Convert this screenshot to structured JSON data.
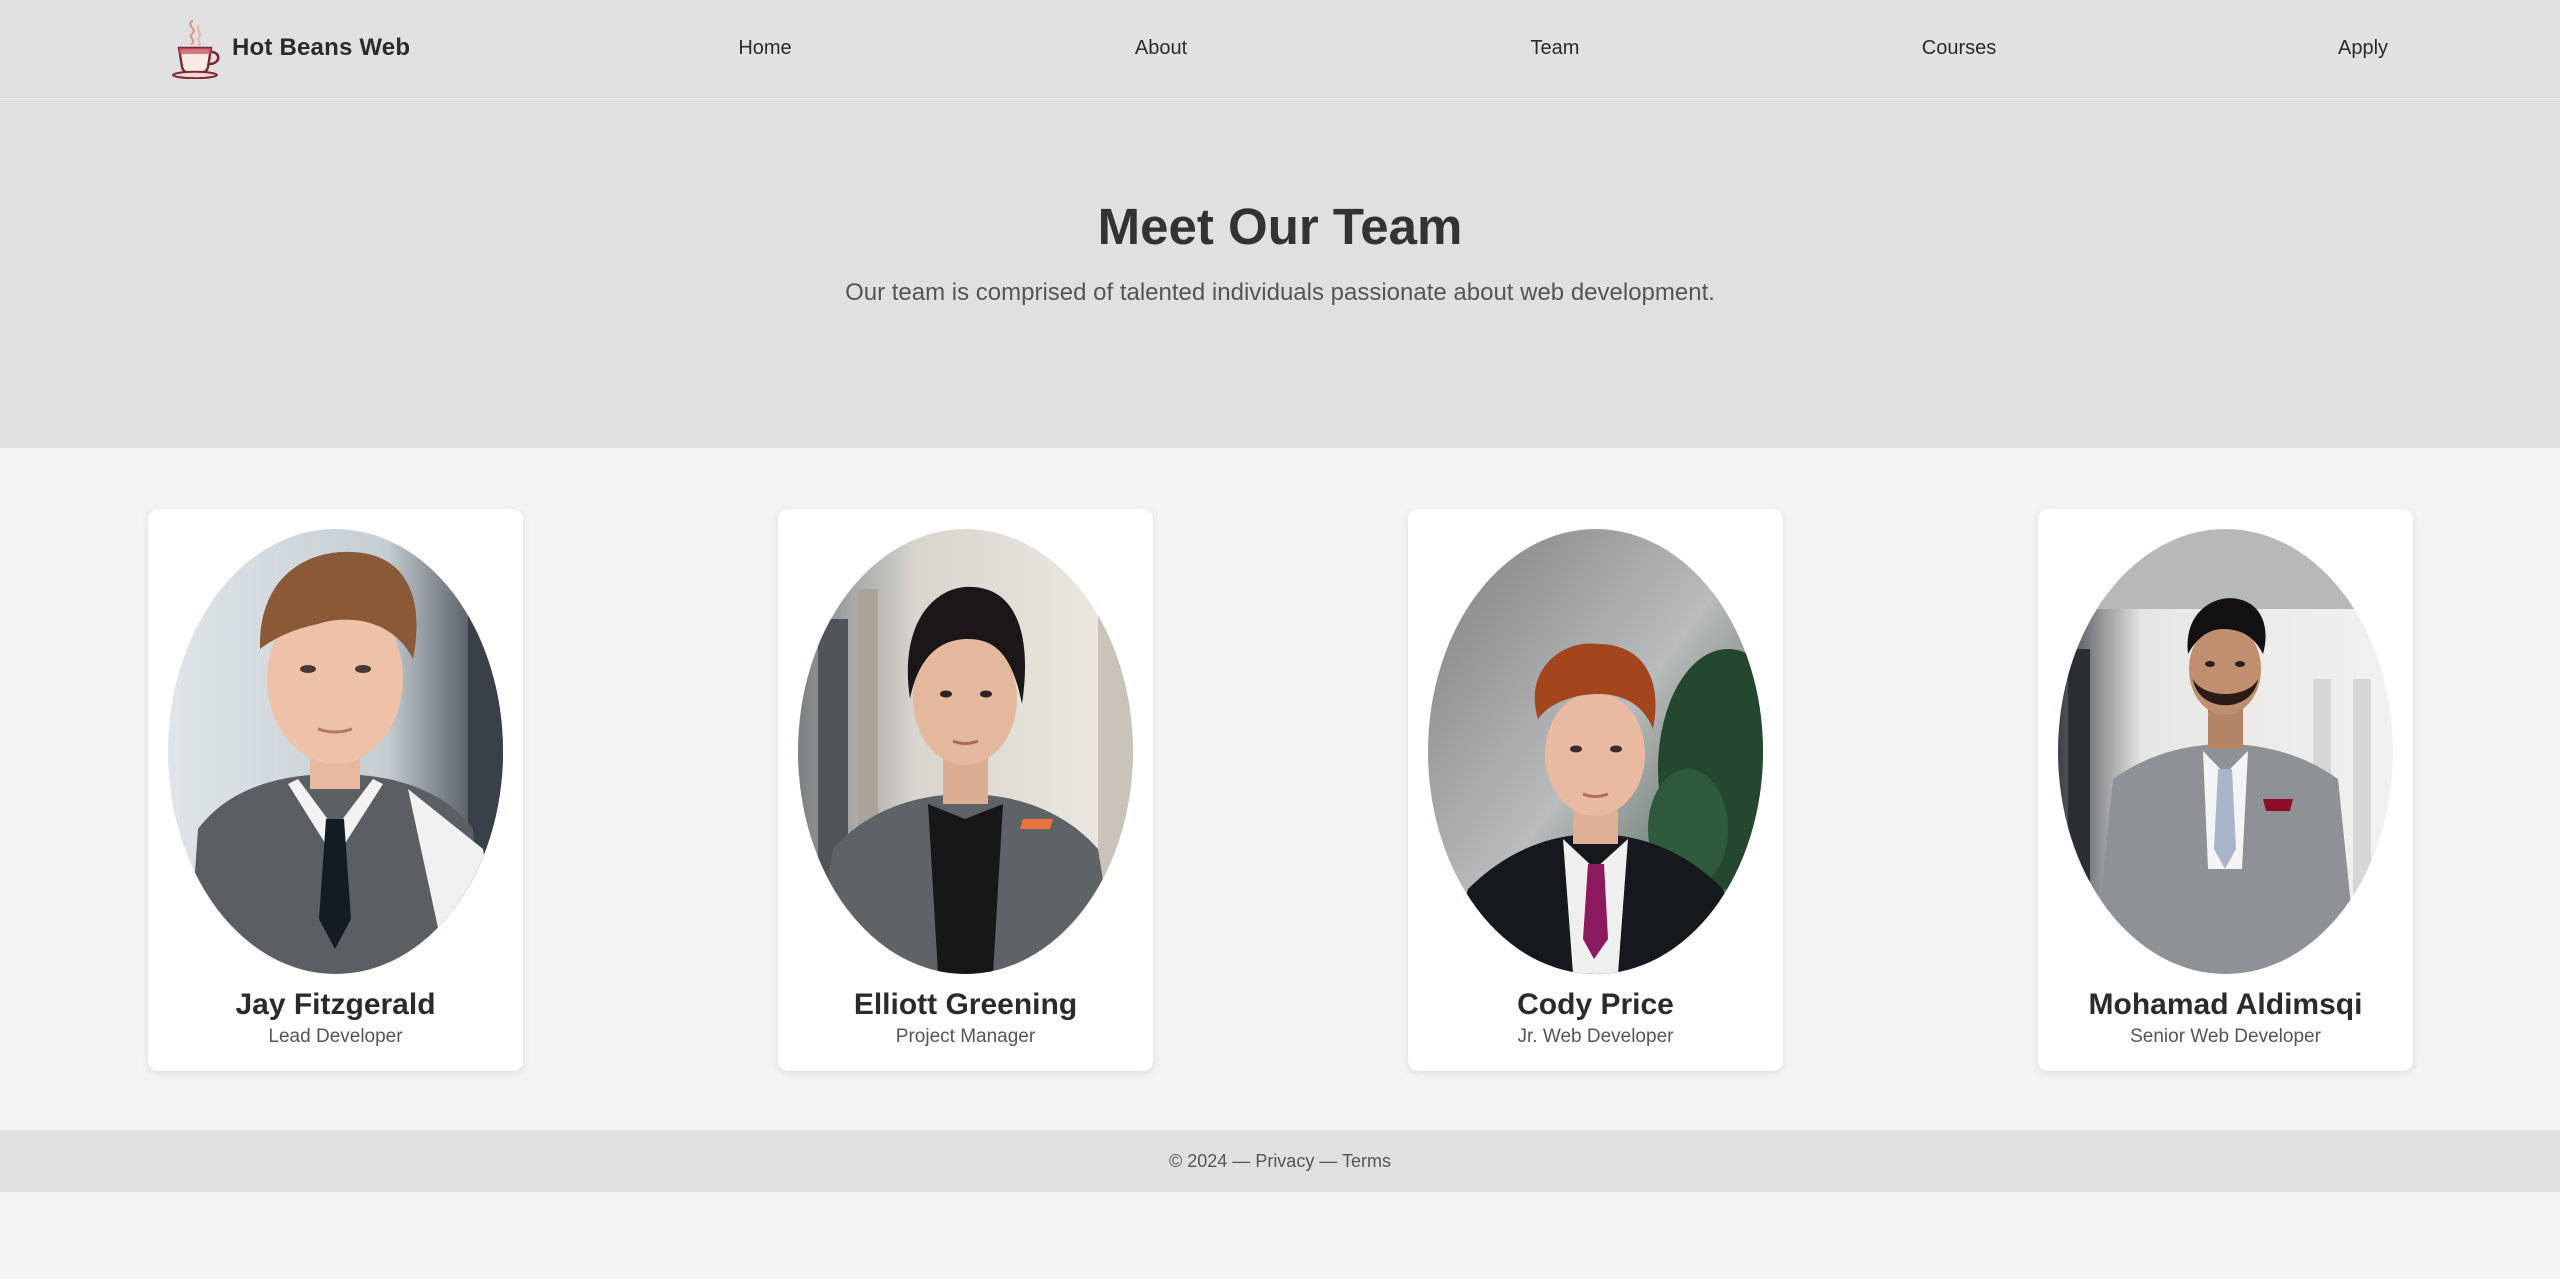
{
  "header": {
    "brand_name": "Hot Beans Web",
    "logo_icon": "coffee-cup-icon",
    "nav": [
      {
        "label": "Home"
      },
      {
        "label": "About"
      },
      {
        "label": "Team"
      },
      {
        "label": "Courses"
      },
      {
        "label": "Apply"
      }
    ]
  },
  "hero": {
    "title": "Meet Our Team",
    "subtitle": "Our team is comprised of talented individuals passionate about web development."
  },
  "team": [
    {
      "name": "Jay Fitzgerald",
      "role": "Lead Developer",
      "photo": "portrait-photo"
    },
    {
      "name": "Elliott Greening",
      "role": "Project Manager",
      "photo": "portrait-photo"
    },
    {
      "name": "Cody Price",
      "role": "Jr. Web Developer",
      "photo": "portrait-photo"
    },
    {
      "name": "Mohamad Aldimsqi",
      "role": "Senior Web Developer",
      "photo": "portrait-photo"
    }
  ],
  "footer": {
    "copyright": "© 2024",
    "separator": "—",
    "privacy_label": "Privacy",
    "terms_label": "Terms"
  },
  "colors": {
    "header_bg": "#e1e1e1",
    "hero_bg": "#e0e0e0",
    "page_bg": "#f4f4f4",
    "card_bg": "#ffffff",
    "text_dark": "#333333",
    "text_muted": "#555555"
  }
}
